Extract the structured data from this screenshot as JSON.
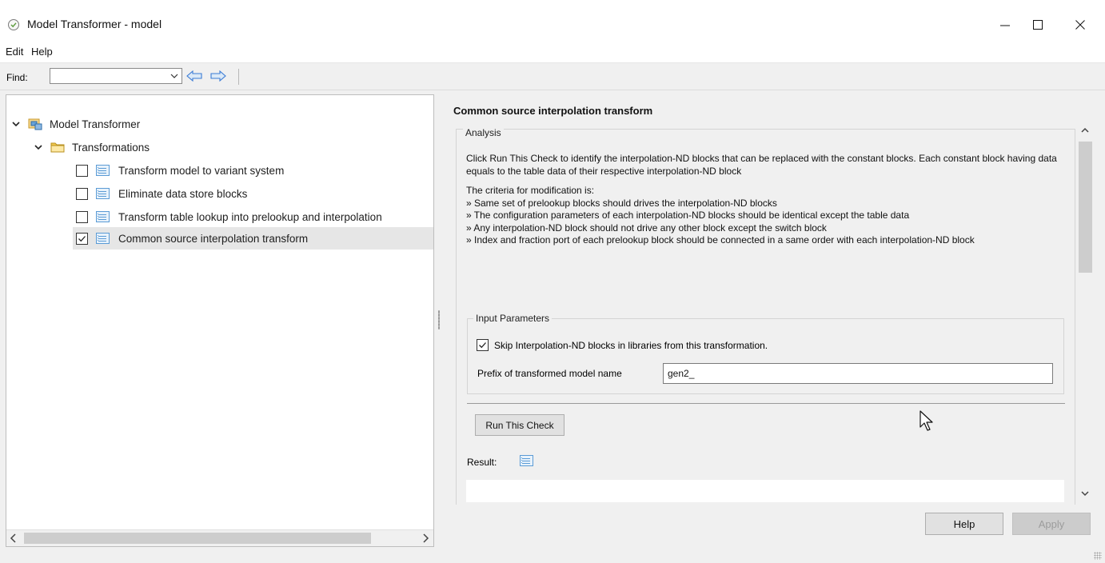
{
  "window": {
    "title": "Model Transformer - model",
    "controls": {
      "minimize": "minimize",
      "maximize": "maximize",
      "close": "close"
    }
  },
  "menu": {
    "items": [
      "Edit",
      "Help"
    ]
  },
  "find": {
    "label": "Find:",
    "value": ""
  },
  "tree": {
    "root": "Model Transformer",
    "folder": "Transformations",
    "items": [
      {
        "label": "Transform model to variant system",
        "checked": false
      },
      {
        "label": "Eliminate data store blocks",
        "checked": false
      },
      {
        "label": "Transform table lookup into prelookup and interpolation",
        "checked": false
      },
      {
        "label": "Common source interpolation transform",
        "checked": true,
        "selected": true
      }
    ]
  },
  "detail": {
    "title": "Common source interpolation transform",
    "analysis_legend": "Analysis",
    "description": "Click Run This Check to identify the interpolation-ND blocks that can be replaced with the constant blocks. Each constant block having data equals to the table data of their respective interpolation-ND block",
    "criteria_heading": "The criteria for modification is:",
    "criteria": [
      "» Same set of prelookup blocks should drives the interpolation-ND blocks",
      "» The configuration parameters of each interpolation-ND blocks should be identical except the table data",
      "» Any interpolation-ND block should not drive any other block except the switch block",
      "» Index and fraction port of each prelookup block should be connected in a same order with each interpolation-ND block"
    ],
    "params_legend": "Input Parameters",
    "skip_label": "Skip Interpolation-ND blocks in libraries from this transformation.",
    "skip_checked": true,
    "prefix_label": "Prefix of transformed model name",
    "prefix_value": "gen2_",
    "run_button": "Run This Check",
    "result_label": "Result:"
  },
  "footer": {
    "help": "Help",
    "apply": "Apply"
  },
  "colors": {
    "accent_blue": "#5b9bd5",
    "folder_yellow": "#f2c94c",
    "disabled_text": "#9c9c9c"
  }
}
